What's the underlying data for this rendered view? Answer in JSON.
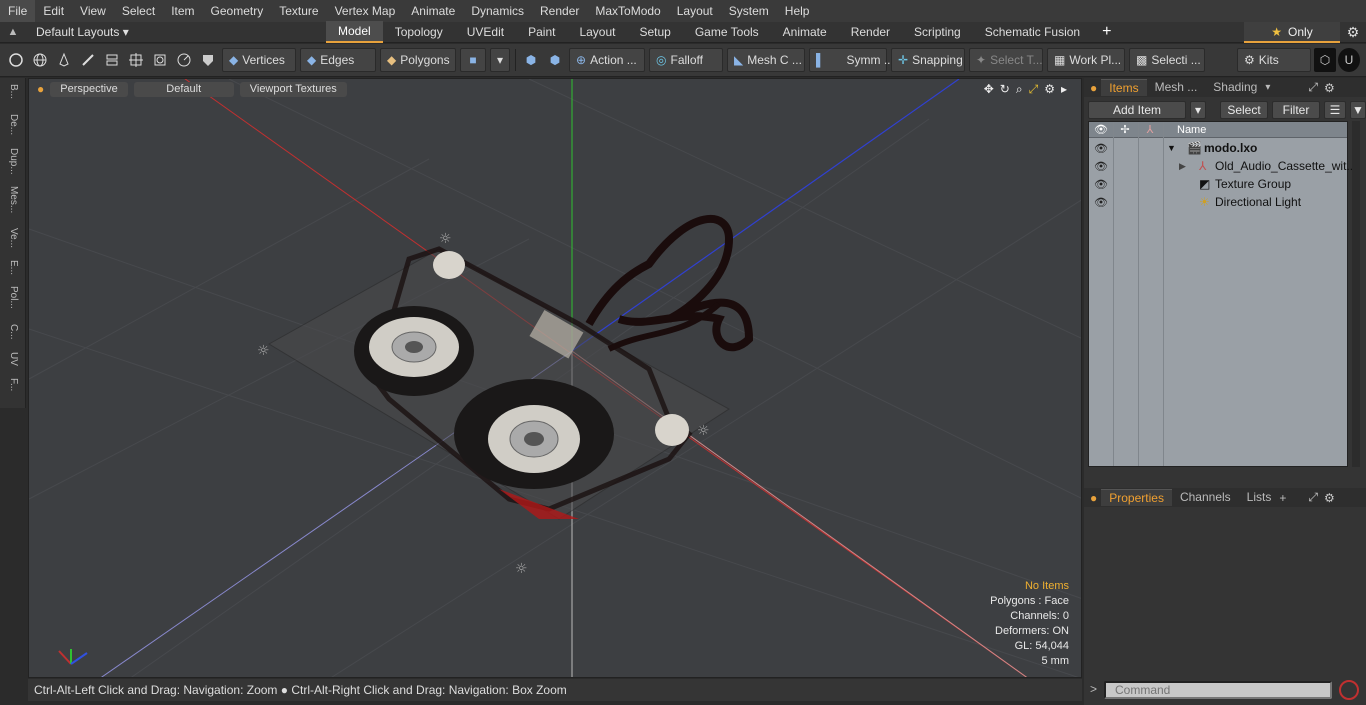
{
  "menu": [
    "File",
    "Edit",
    "View",
    "Select",
    "Item",
    "Geometry",
    "Texture",
    "Vertex Map",
    "Animate",
    "Dynamics",
    "Render",
    "MaxToModo",
    "Layout",
    "System",
    "Help"
  ],
  "layout_bar": {
    "layouts_label": "Default Layouts",
    "tabs": [
      "Model",
      "Topology",
      "UVEdit",
      "Paint",
      "Layout",
      "Setup",
      "Game Tools",
      "Animate",
      "Render",
      "Scripting",
      "Schematic Fusion"
    ],
    "active_tab": "Model",
    "only_label": "Only"
  },
  "toolbar": {
    "vertices": "Vertices",
    "edges": "Edges",
    "polygons": "Polygons",
    "action": "Action ...",
    "falloff": "Falloff",
    "mesh": "Mesh C ...",
    "symm": "Symm ...",
    "snapping": "Snapping",
    "select_t": "Select T...",
    "work_pl": "Work Pl...",
    "selecti": "Selecti ...",
    "kits": "Kits"
  },
  "left_tabs": [
    "B...",
    "De...",
    "Dup...",
    "Mes...",
    "Ve...",
    "E...",
    "Pol...",
    "C...",
    "UV",
    "F..."
  ],
  "viewport": {
    "view_label": "Perspective",
    "shading_label": "Default",
    "textures_label": "Viewport Textures",
    "info": {
      "no_items": "No Items",
      "polygons": "Polygons : Face",
      "channels": "Channels: 0",
      "deformers": "Deformers: ON",
      "gl": "GL: 54,044",
      "unit": "5 mm"
    }
  },
  "status": "Ctrl-Alt-Left Click and Drag: Navigation: Zoom ● Ctrl-Alt-Right Click and Drag: Navigation: Box Zoom",
  "items_panel": {
    "tabs": [
      "Items",
      "Mesh ...",
      "Shading"
    ],
    "add_item": "Add Item",
    "select": "Select",
    "filter": "Filter",
    "col_name": "Name",
    "rows": [
      {
        "name": "modo.lxo"
      },
      {
        "name": "Old_Audio_Cassette_wit..."
      },
      {
        "name": "Texture Group"
      },
      {
        "name": "Directional Light"
      }
    ]
  },
  "properties_panel": {
    "tabs": [
      "Properties",
      "Channels",
      "Lists"
    ],
    "command_placeholder": "Command"
  }
}
